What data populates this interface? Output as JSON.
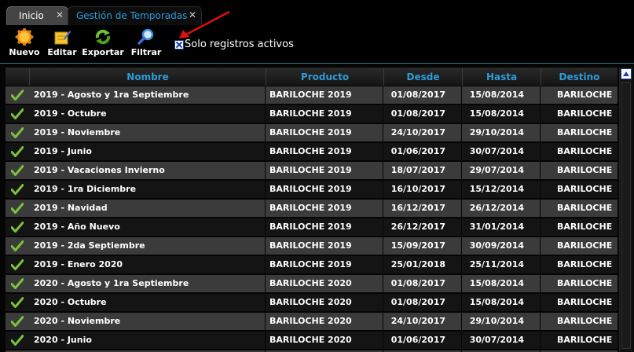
{
  "tabs": [
    {
      "label": "Inicio",
      "close": "✕"
    },
    {
      "label": "Gestión de Temporadas",
      "close": "✕"
    }
  ],
  "toolbar": {
    "nuevo": "Nuevo",
    "editar": "Editar",
    "exportar": "Exportar",
    "filtrar": "Filtrar"
  },
  "filter": {
    "label": "Solo registros activos",
    "checked": true
  },
  "colors": {
    "accent": "#2d9bd8",
    "check": "#7cc23b",
    "row_odd": "#3b3b3b",
    "row_even": "#141414",
    "annotation": "#e01010"
  },
  "icons": [
    "sun-icon",
    "edit-icon",
    "refresh-icon",
    "search-icon",
    "checkmark-icon",
    "scroll-up-icon"
  ],
  "grid": {
    "columns": [
      "Nombre",
      "Producto",
      "Desde",
      "Hasta",
      "Destino"
    ],
    "rows": [
      {
        "nombre": "2019 - Agosto y 1ra Septiembre",
        "producto": "BARILOCHE 2019",
        "desde": "01/08/2017",
        "hasta": "15/08/2014",
        "destino": "BARILOCHE"
      },
      {
        "nombre": "2019 - Octubre",
        "producto": "BARILOCHE 2019",
        "desde": "01/08/2017",
        "hasta": "15/08/2014",
        "destino": "BARILOCHE"
      },
      {
        "nombre": "2019 - Noviembre",
        "producto": "BARILOCHE 2019",
        "desde": "24/10/2017",
        "hasta": "29/10/2014",
        "destino": "BARILOCHE"
      },
      {
        "nombre": "2019 - Junio",
        "producto": "BARILOCHE 2019",
        "desde": "01/06/2017",
        "hasta": "30/07/2014",
        "destino": "BARILOCHE"
      },
      {
        "nombre": "2019 - Vacaciones Invierno",
        "producto": "BARILOCHE 2019",
        "desde": "18/07/2017",
        "hasta": "29/07/2014",
        "destino": "BARILOCHE"
      },
      {
        "nombre": "2019 - 1ra Diciembre",
        "producto": "BARILOCHE 2019",
        "desde": "16/10/2017",
        "hasta": "15/12/2014",
        "destino": "BARILOCHE"
      },
      {
        "nombre": "2019 - Navidad",
        "producto": "BARILOCHE 2019",
        "desde": "16/12/2017",
        "hasta": "26/12/2014",
        "destino": "BARILOCHE"
      },
      {
        "nombre": "2019 - Año Nuevo",
        "producto": "BARILOCHE 2019",
        "desde": "26/12/2017",
        "hasta": "31/01/2014",
        "destino": "BARILOCHE"
      },
      {
        "nombre": "2019 - 2da Septiembre",
        "producto": "BARILOCHE 2019",
        "desde": "15/09/2017",
        "hasta": "30/09/2014",
        "destino": "BARILOCHE"
      },
      {
        "nombre": "2019 - Enero 2020",
        "producto": "BARILOCHE 2019",
        "desde": "25/01/2018",
        "hasta": "25/11/2014",
        "destino": "BARILOCHE"
      },
      {
        "nombre": "2020 - Agosto y 1ra Septiembre",
        "producto": "BARILOCHE 2020",
        "desde": "01/08/2017",
        "hasta": "15/08/2014",
        "destino": "BARILOCHE"
      },
      {
        "nombre": "2020 - Octubre",
        "producto": "BARILOCHE 2020",
        "desde": "01/08/2017",
        "hasta": "15/08/2014",
        "destino": "BARILOCHE"
      },
      {
        "nombre": "2020 - Noviembre",
        "producto": "BARILOCHE 2020",
        "desde": "24/10/2017",
        "hasta": "29/10/2014",
        "destino": "BARILOCHE"
      },
      {
        "nombre": "2020 - Junio",
        "producto": "BARILOCHE 2020",
        "desde": "01/06/2017",
        "hasta": "30/07/2014",
        "destino": "BARILOCHE"
      },
      {
        "nombre": "",
        "producto": "",
        "desde": "",
        "hasta": "",
        "destino": ""
      }
    ]
  }
}
